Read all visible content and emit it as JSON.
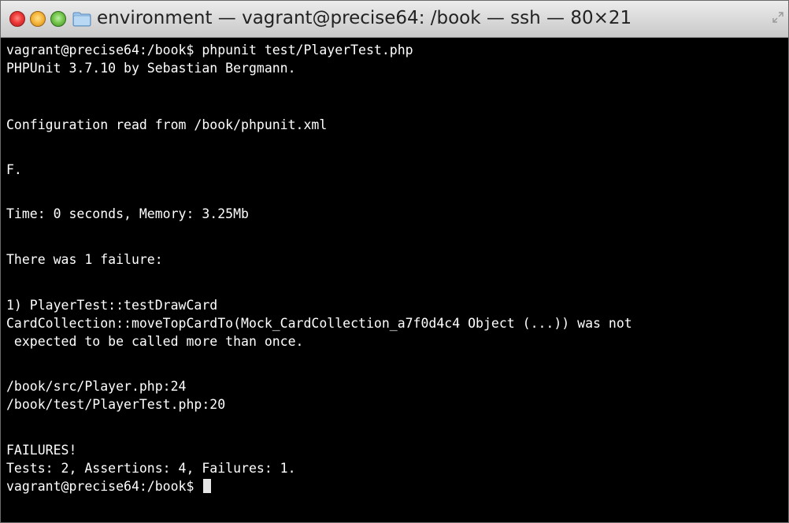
{
  "window": {
    "title": "environment — vagrant@precise64: /book — ssh — 80×21",
    "icons": [
      "close-icon",
      "minimize-icon",
      "zoom-icon",
      "folder-icon",
      "fullscreen-icon"
    ]
  },
  "terminal": {
    "lines": [
      "vagrant@precise64:/book$ phpunit test/PlayerTest.php",
      "PHPUnit 3.7.10 by Sebastian Bergmann.",
      "",
      "Configuration read from /book/phpunit.xml",
      "",
      "F.",
      "",
      "Time: 0 seconds, Memory: 3.25Mb",
      "",
      "There was 1 failure:",
      "",
      "1) PlayerTest::testDrawCard",
      "CardCollection::moveTopCardTo(Mock_CardCollection_a7f0d4c4 Object (...)) was not",
      " expected to be called more than once.",
      "",
      "/book/src/Player.php:24",
      "/book/test/PlayerTest.php:20",
      "",
      "FAILURES!",
      "Tests: 2, Assertions: 4, Failures: 1.",
      "vagrant@precise64:/book$ "
    ]
  }
}
